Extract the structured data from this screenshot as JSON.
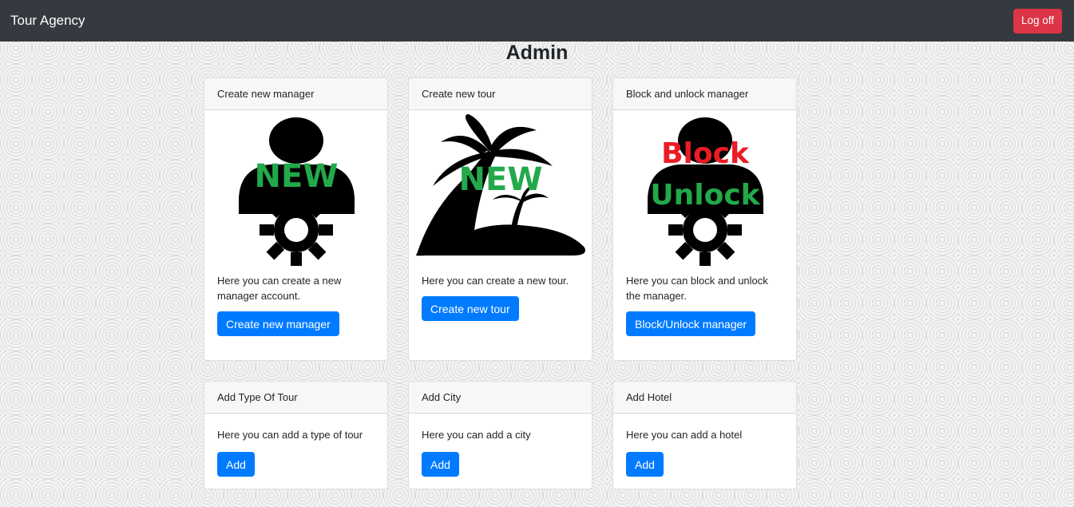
{
  "navbar": {
    "brand": "Tour Agency",
    "logoff_label": "Log off"
  },
  "page": {
    "title": "Admin"
  },
  "cards": [
    {
      "header": "Create new manager",
      "badge": "NEW",
      "text": "Here you can create a new manager account.",
      "button": "Create new manager"
    },
    {
      "header": "Create new tour",
      "badge": "NEW",
      "text": "Here you can create a new tour.",
      "button": "Create new tour"
    },
    {
      "header": "Block and unlock manager",
      "badge_top": "Block",
      "badge_bottom": "Unlock",
      "text": "Here you can block and unlock the manager.",
      "button": "Block/Unlock manager"
    },
    {
      "header": "Add Type Of Tour",
      "text": "Here you can add a type of tour",
      "button": "Add"
    },
    {
      "header": "Add City",
      "text": "Here you can add a city",
      "button": "Add"
    },
    {
      "header": "Add Hotel",
      "text": "Here you can add a hotel",
      "button": "Add"
    }
  ],
  "colors": {
    "navbar": "#343a40",
    "danger": "#dc3545",
    "primary": "#007bff",
    "badge_green": "#22a94a",
    "badge_red": "#ec1c24"
  }
}
